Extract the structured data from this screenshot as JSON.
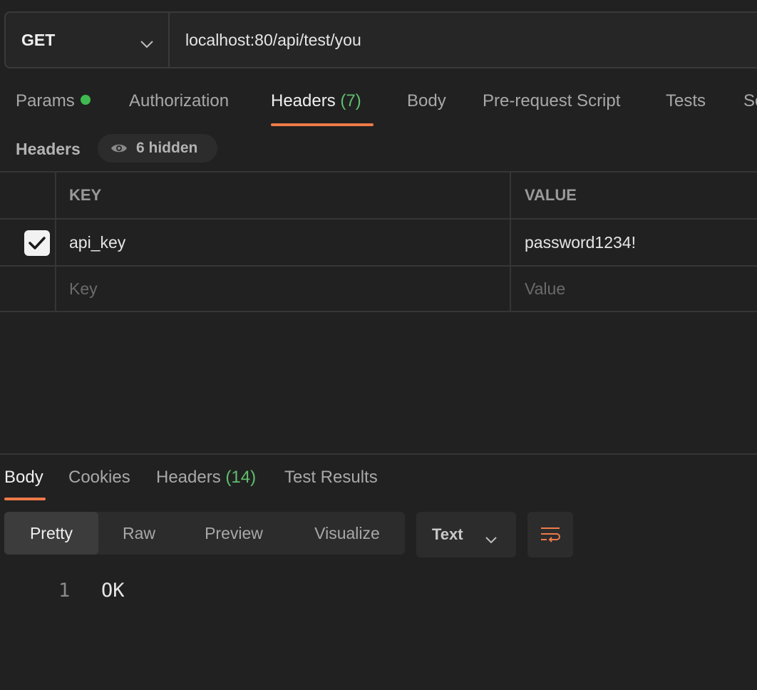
{
  "request": {
    "method": "GET",
    "url": "localhost:80/api/test/you"
  },
  "request_tabs": [
    {
      "label": "Params",
      "has_dot": true
    },
    {
      "label": "Authorization"
    },
    {
      "label": "Headers",
      "count": "(7)",
      "active": true
    },
    {
      "label": "Body"
    },
    {
      "label": "Pre-request Script"
    },
    {
      "label": "Tests"
    },
    {
      "label": "Se"
    }
  ],
  "headers_section": {
    "title": "Headers",
    "hidden_label": "6 hidden"
  },
  "headers_table": {
    "columns": [
      "KEY",
      "VALUE"
    ],
    "rows": [
      {
        "checked": true,
        "key": "api_key",
        "value": "password1234!"
      }
    ],
    "placeholder": {
      "key": "Key",
      "value": "Value"
    }
  },
  "response_tabs": [
    {
      "label": "Body",
      "active": true
    },
    {
      "label": "Cookies"
    },
    {
      "label": "Headers",
      "count": "(14)"
    },
    {
      "label": "Test Results"
    }
  ],
  "view_modes": [
    "Pretty",
    "Raw",
    "Preview",
    "Visualize"
  ],
  "active_view_mode": "Pretty",
  "format_select": "Text",
  "response_body": {
    "lines": [
      {
        "number": "1",
        "text": "OK"
      }
    ]
  },
  "colors": {
    "accent": "#ef7a48",
    "status_green": "#3fb950",
    "background": "#212121"
  }
}
